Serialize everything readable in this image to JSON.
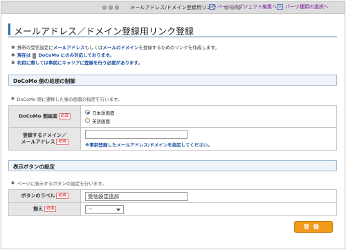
{
  "window": {
    "title": "メールアドレス/ドメイン登録用リンク"
  },
  "header": {
    "title": "メールアドレス／ドメイン登録用リンク登録",
    "links": [
      {
        "icon": "link-icon",
        "label": "ページ オブジェクト編集へ"
      },
      {
        "icon": "link-icon",
        "label": "パーツ種類の選択へ"
      }
    ]
  },
  "notes": {
    "line1_pre": "携帯の受信設定に",
    "line1_hl1": "メールアドレス",
    "line1_mid": "もしくは",
    "line1_hl2": "メールのドメイン",
    "line1_post": "を登録するためのリンクを作成します。",
    "line2_pre": "現在は",
    "line2_post": "DoCoMo にのみ対応しております。",
    "line3": "利用に際しては事前にキャリアに登録を行う必要があります。"
  },
  "section1": {
    "title": "DoCoMo 側の処理の制御",
    "desc": "DoCoMo 側に遷移した後の画面の指定を行います。",
    "screen_label": "DoCoMo 側画面",
    "required": "必須",
    "radio_options": [
      {
        "label": "日本語画面",
        "checked": true
      },
      {
        "label": "英語画面",
        "checked": false
      }
    ],
    "domain_label_1": "登録するドメイン／",
    "domain_label_2": "メールアドレス",
    "domain_value": "",
    "domain_hint": "※事前登録したメールアドレス/ドメインを指定してください。"
  },
  "section2": {
    "title": "表示ボタンの設定",
    "desc": "ページに表示するボタンの設定を行います。",
    "button_label": "ボタンのラベル",
    "button_value": "受信設定追加",
    "align_label": "揃え",
    "align_value": "－",
    "required": "必須"
  },
  "submit_label": "登録"
}
